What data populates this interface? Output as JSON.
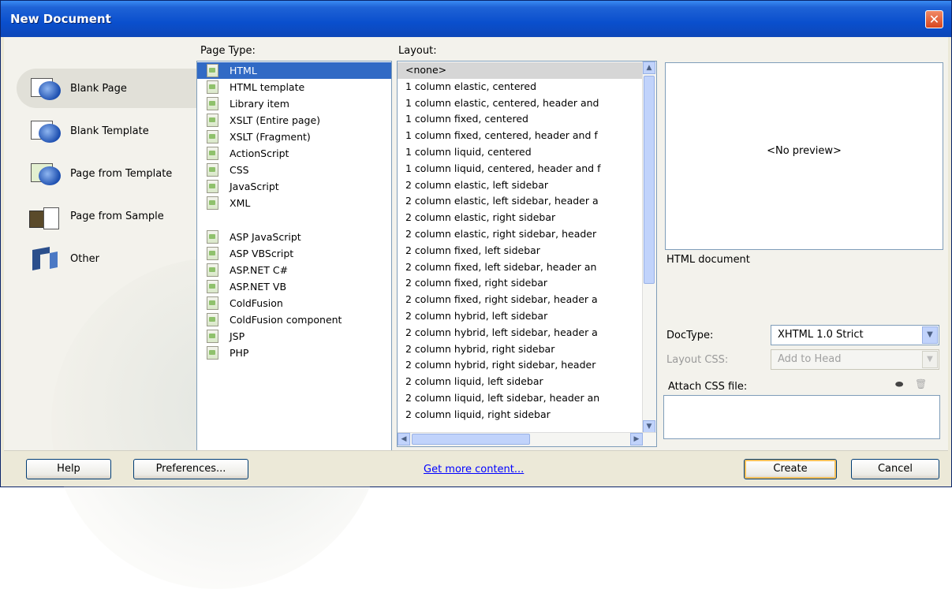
{
  "window": {
    "title": "New Document",
    "close_glyph": "✕"
  },
  "categories": [
    {
      "label": "Blank Page",
      "icon": "blank-page-icon",
      "selected": true
    },
    {
      "label": "Blank Template",
      "icon": "blank-template-icon",
      "selected": false
    },
    {
      "label": "Page from Template",
      "icon": "page-from-template-icon",
      "selected": false
    },
    {
      "label": "Page from Sample",
      "icon": "page-from-sample-icon",
      "selected": false
    },
    {
      "label": "Other",
      "icon": "other-icon",
      "selected": false
    }
  ],
  "page_type": {
    "label": "Page Type:",
    "group1": [
      "HTML",
      "HTML template",
      "Library item",
      "XSLT (Entire page)",
      "XSLT (Fragment)",
      "ActionScript",
      "CSS",
      "JavaScript",
      "XML"
    ],
    "group2": [
      "ASP JavaScript",
      "ASP VBScript",
      "ASP.NET C#",
      "ASP.NET VB",
      "ColdFusion",
      "ColdFusion component",
      "JSP",
      "PHP"
    ],
    "selected": "HTML"
  },
  "layout": {
    "label": "Layout:",
    "items": [
      "<none>",
      "1 column elastic, centered",
      "1 column elastic, centered, header and",
      "1 column fixed, centered",
      "1 column fixed, centered, header and f",
      "1 column liquid, centered",
      "1 column liquid, centered, header and f",
      "2 column elastic, left sidebar",
      "2 column elastic, left sidebar, header a",
      "2 column elastic, right sidebar",
      "2 column elastic, right sidebar, header",
      "2 column fixed, left sidebar",
      "2 column fixed, left sidebar, header an",
      "2 column fixed, right sidebar",
      "2 column fixed, right sidebar, header a",
      "2 column hybrid, left sidebar",
      "2 column hybrid, left sidebar, header a",
      "2 column hybrid, right sidebar",
      "2 column hybrid, right sidebar, header",
      "2 column liquid, left sidebar",
      "2 column liquid, left sidebar, header an",
      "2 column liquid, right sidebar"
    ],
    "selected": "<none>"
  },
  "preview": {
    "text": "<No preview>",
    "description": "HTML document"
  },
  "doctype": {
    "label": "DocType:",
    "value": "XHTML 1.0 Strict"
  },
  "layout_css": {
    "label": "Layout CSS:",
    "value": "Add to Head"
  },
  "attach_css": {
    "label": "Attach CSS file:"
  },
  "footer": {
    "help": "Help",
    "preferences": "Preferences...",
    "get_more": "Get more content...",
    "create": "Create",
    "cancel": "Cancel"
  }
}
